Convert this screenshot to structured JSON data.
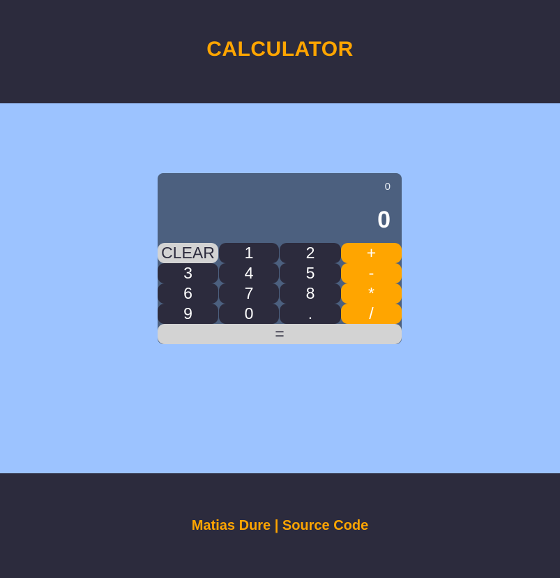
{
  "app": {
    "title": "CALCULATOR"
  },
  "display": {
    "previous": "0",
    "current": "0"
  },
  "keys": {
    "clear": "CLEAR",
    "one": "1",
    "two": "2",
    "plus": "+",
    "three": "3",
    "four": "4",
    "five": "5",
    "minus": "-",
    "six": "6",
    "seven": "7",
    "eight": "8",
    "multiply": "*",
    "nine": "9",
    "zero": "0",
    "dot": ".",
    "divide": "/",
    "equals": "="
  },
  "footer": {
    "author": "Matias Dure",
    "separator": " | ",
    "source": "Source Code"
  },
  "colors": {
    "header_bg": "#2c2b3d",
    "accent": "#ffa500",
    "page_bg": "#9cc3ff",
    "calc_bg": "#4c607f",
    "key_dark": "#2c2b3d",
    "key_light": "#d3d3d3"
  }
}
